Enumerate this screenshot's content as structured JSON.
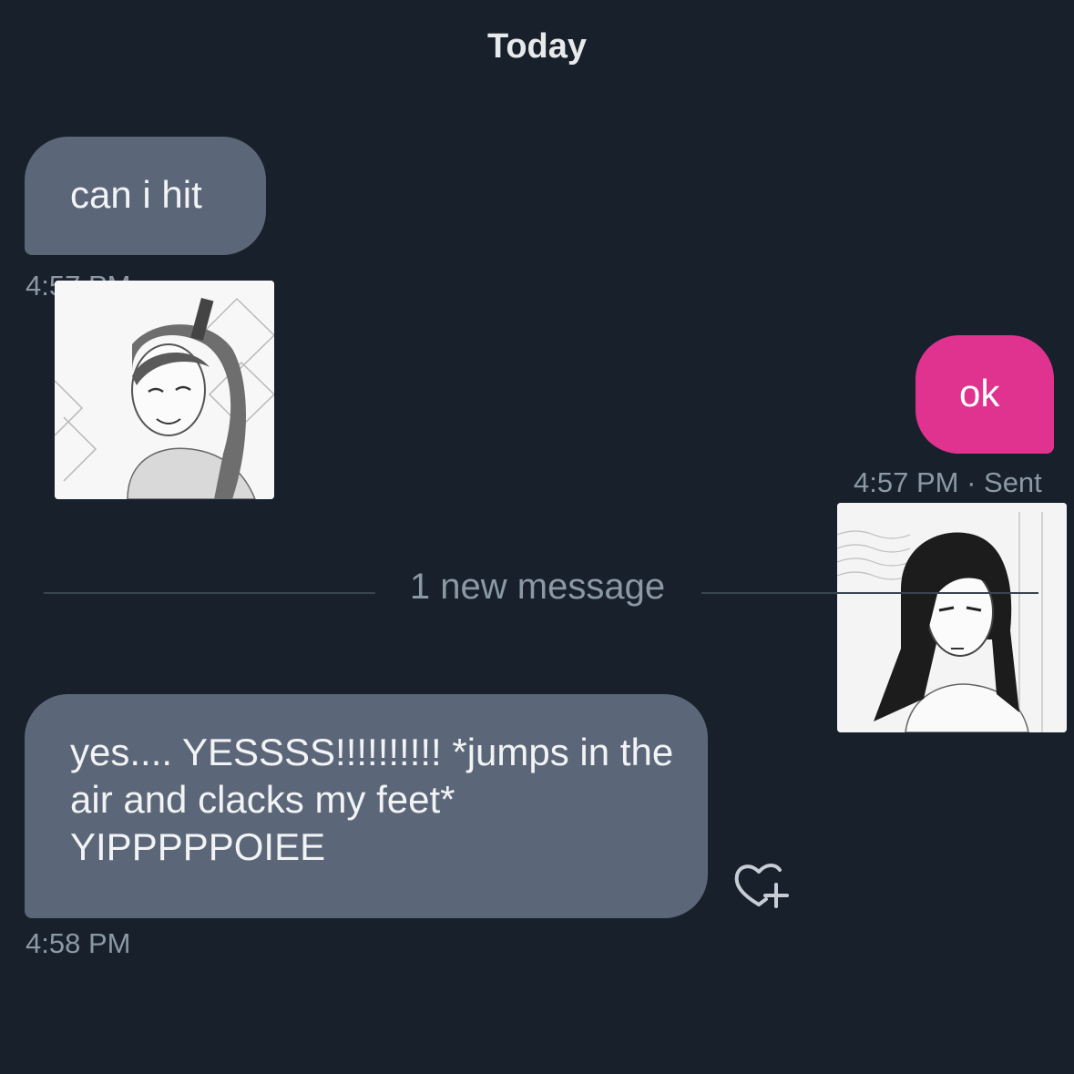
{
  "conversation": {
    "date_header": "Today",
    "divider_label": "1 new message",
    "messages": [
      {
        "text": "can i hit",
        "time": "4:57 PM"
      },
      {
        "text": "ok",
        "time": "4:57 PM",
        "status": "· Sent"
      },
      {
        "text": "yes.... YESSSS!!!!!!!!!! *jumps in the air and clacks my feet* YIPPPPPOIEE",
        "time": "4:58 PM"
      }
    ]
  },
  "icons": {
    "reaction": "heart-plus-icon"
  },
  "colors": {
    "background": "#17202b",
    "incoming_bubble": "#5b6779",
    "outgoing_bubble": "#e0338f",
    "timestamp": "#8b98a5"
  }
}
